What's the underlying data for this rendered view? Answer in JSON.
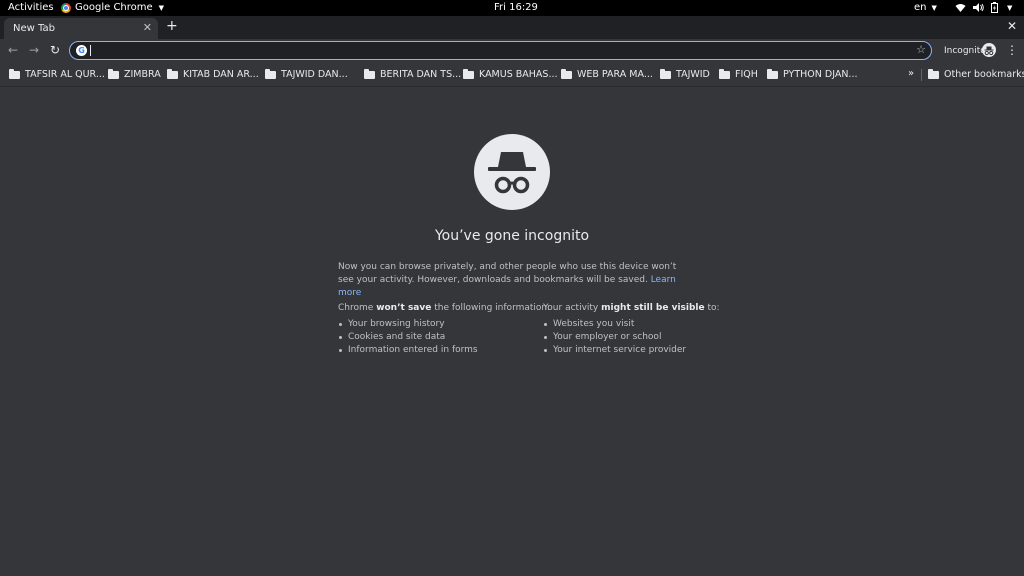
{
  "topbar": {
    "activities": "Activities",
    "app_name": "Google Chrome",
    "clock": "Fri 16:29",
    "lang": "en"
  },
  "tabs": [
    {
      "title": "New Tab"
    }
  ],
  "toolbar": {
    "omnibox_value": "",
    "profile_label": "Incognito"
  },
  "bookmarks": {
    "items": [
      "TAFSIR AL QUR...",
      "ZIMBRA",
      "KITAB DAN AR...",
      "TAJWID DAN...",
      "BERITA DAN TS...",
      "KAMUS BAHAS...",
      "WEB PARA MA...",
      "TAJWID",
      "FIQH",
      "PYTHON DJAN..."
    ],
    "other": "Other bookmarks"
  },
  "incognito": {
    "heading": "You’ve gone incognito",
    "intro": "Now you can browse privately, and other people who use this device won’t see your activity. However, downloads and bookmarks will be saved.",
    "learn_more": "Learn more",
    "left": {
      "prefix": "Chrome",
      "strong": "won’t save",
      "suffix": "the following information:",
      "items": [
        "Your browsing history",
        "Cookies and site data",
        "Information entered in forms"
      ]
    },
    "right": {
      "prefix": "Your activity",
      "strong": "might still be visible",
      "suffix": "to:",
      "items": [
        "Websites you visit",
        "Your employer or school",
        "Your internet service provider"
      ]
    }
  },
  "colors": {
    "page_bg": "#35363a",
    "frame_bg": "#202124",
    "accent": "#8ab4f8",
    "text": "#e8eaed"
  }
}
